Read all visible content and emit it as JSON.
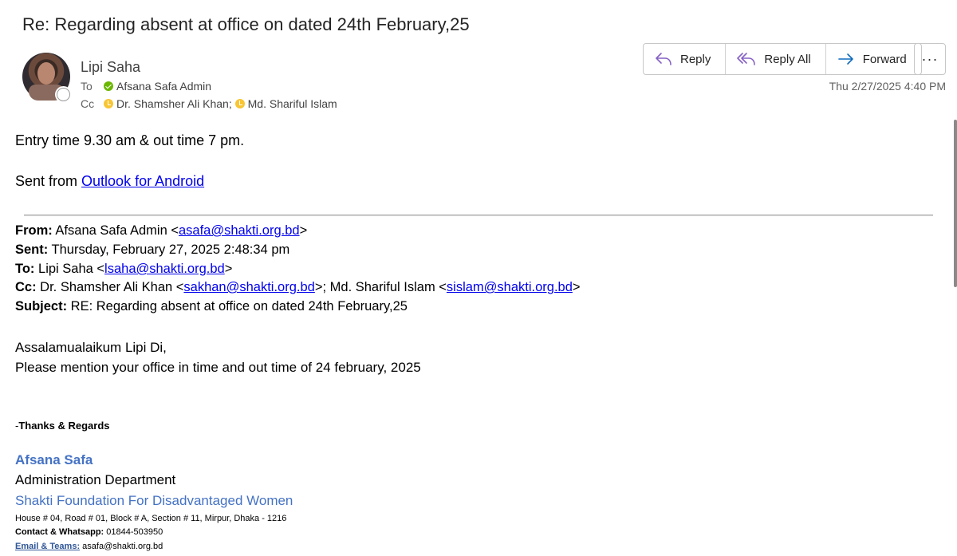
{
  "subject": "Re: Regarding absent at office on dated 24th February,25",
  "sender": {
    "name": "Lipi Saha",
    "to_label": "To",
    "cc_label": "Cc",
    "to": [
      {
        "name": "Afsana Safa Admin",
        "status": "available",
        "sep": ""
      }
    ],
    "cc": [
      {
        "name": "Dr. Shamsher  Ali Khan",
        "status": "away",
        "sep": ";"
      },
      {
        "name": "Md. Shariful Islam",
        "status": "away",
        "sep": ""
      }
    ]
  },
  "actions": {
    "reply": "Reply",
    "reply_all": "Reply All",
    "forward": "Forward",
    "more": "···"
  },
  "timestamp": "Thu 2/27/2025 4:40 PM",
  "body": {
    "line1": "Entry time 9.30 am & out time 7 pm.",
    "sent_from_prefix": "Sent from ",
    "sent_from_link": "Outlook for Android"
  },
  "quoted": {
    "from_label": "From:",
    "from_name": " Afsana Safa Admin <",
    "from_email": "asafa@shakti.org.bd",
    "from_close": ">",
    "sent_label": "Sent:",
    "sent_value": " Thursday, February 27, 2025 2:48:34 pm",
    "to_label": "To:",
    "to_name": " Lipi Saha <",
    "to_email": "lsaha@shakti.org.bd",
    "to_close": ">",
    "cc_label": "Cc:",
    "cc_name1": " Dr. Shamsher  Ali Khan <",
    "cc_email1": "sakhan@shakti.org.bd",
    "cc_mid": ">; Md. Shariful Islam <",
    "cc_email2": "sislam@shakti.org.bd",
    "cc_close": ">",
    "subject_label": "Subject:",
    "subject_value": " RE: Regarding absent at office on dated 24th February,25",
    "greeting": "Assalamualaikum Lipi Di,",
    "message": "Please mention your office in time and out time of 24 february, 2025",
    "thanks_dash": "-",
    "thanks": "Thanks & Regards",
    "sig_name": "Afsana Safa",
    "sig_dept": "Administration Department",
    "sig_org": "Shakti Foundation For Disadvantaged Women",
    "sig_address": "House # 04, Road # 01, Block # A, Section # 11, Mirpur, Dhaka - 1216",
    "sig_contact_label": "Contact & Whatsapp:",
    "sig_contact_value": " 01844-503950",
    "sig_email_label": "Email & Teams:",
    "sig_email_value": " asafa@shakti.org.bd"
  }
}
